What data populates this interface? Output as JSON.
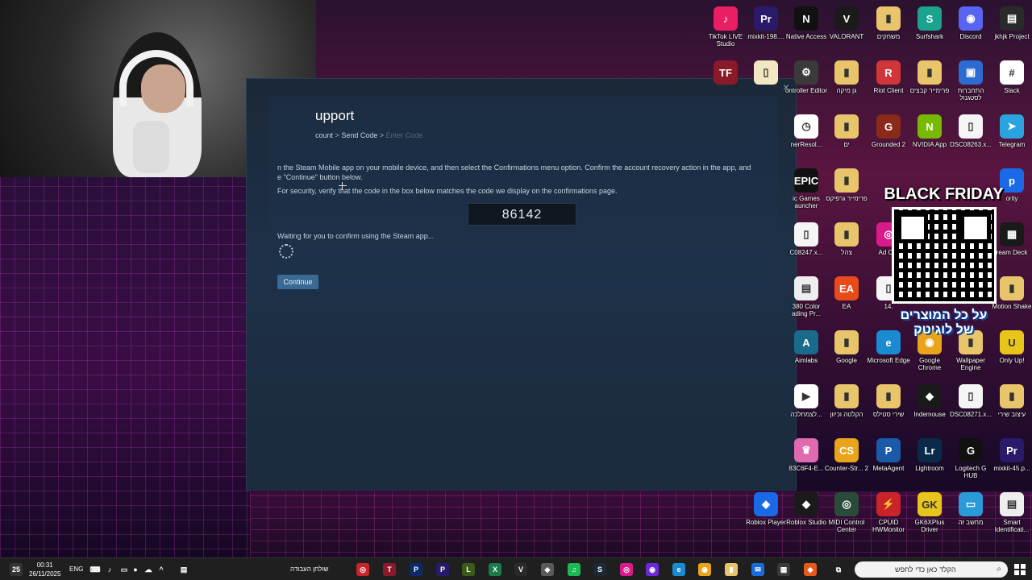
{
  "steam": {
    "title": "upport",
    "breadcrumb": [
      "count",
      "Send Code",
      "Enter Code"
    ],
    "crumb_sep": ">",
    "instruction_line1": "n the Steam Mobile app on your mobile device, and then select the Confirmations menu option. Confirm the account recovery action in the app, and",
    "instruction_line2": "e \"Continue\" button below.",
    "security_text": "For security, verify that the code in the box below matches the code we display on the confirmations page.",
    "code": "86142",
    "waiting_text": "Waiting for you to confirm using the Steam app...",
    "continue_label": "Continue",
    "close_glyph": "×"
  },
  "desktop_icons": [
    {
      "label": "TikTok LIVE Studio",
      "glyph": "♪",
      "color": "#e91e63",
      "icon": "tiktok-icon"
    },
    {
      "label": "mixkit-198....",
      "glyph": "Pr",
      "color": "#2a1a6a",
      "icon": "premiere-icon"
    },
    {
      "label": "Native Access",
      "glyph": "N",
      "color": "#111111",
      "icon": "native-access-icon"
    },
    {
      "label": "VALORANT",
      "glyph": "V",
      "color": "#1a1a1a",
      "icon": "valorant-icon"
    },
    {
      "label": "משחקים",
      "glyph": "▮",
      "color": "#e8c56a",
      "icon": "folder-icon"
    },
    {
      "label": "Surfshark",
      "glyph": "S",
      "color": "#1aa38f",
      "icon": "surfshark-icon"
    },
    {
      "label": "Discord",
      "glyph": "◉",
      "color": "#5865f2",
      "icon": "discord-icon"
    },
    {
      "label": "jkhjk Project",
      "glyph": "▤",
      "color": "#2a2a2a",
      "icon": "project-icon"
    },
    {
      "label": "",
      "glyph": "TF",
      "color": "#8a1a2a",
      "icon": "tf-icon"
    },
    {
      "label": "",
      "glyph": "▯",
      "color": "#f1e7c3",
      "icon": "file-icon"
    },
    {
      "label": "ontroller Editor",
      "glyph": "⚙",
      "color": "#3a3a3a",
      "icon": "controller-icon"
    },
    {
      "label": "גן מיקה",
      "glyph": "▮",
      "color": "#e8c56a",
      "icon": "folder-icon"
    },
    {
      "label": "Riot Client",
      "glyph": "R",
      "color": "#d13639",
      "icon": "riot-icon"
    },
    {
      "label": "פרימייר קבצים",
      "glyph": "▮",
      "color": "#e8c56a",
      "icon": "folder-icon"
    },
    {
      "label": "התחברות לסטגנול",
      "glyph": "▣",
      "color": "#2c6bd1",
      "icon": "connection-icon"
    },
    {
      "label": "Slack",
      "glyph": "#",
      "color": "#ffffff",
      "icon": "slack-icon"
    },
    {
      "label": "nerResol...",
      "glyph": "◷",
      "color": "#ffffff",
      "icon": "clock-icon"
    },
    {
      "label": "ים",
      "glyph": "▮",
      "color": "#e8c56a",
      "icon": "folder-icon"
    },
    {
      "label": "Grounded 2",
      "glyph": "G",
      "color": "#8a2a1a",
      "icon": "grounded-icon"
    },
    {
      "label": "NVIDIA App",
      "glyph": "N",
      "color": "#76b900",
      "icon": "nvidia-icon"
    },
    {
      "label": "DSC08263.x...",
      "glyph": "▯",
      "color": "#f5f5f5",
      "icon": "file-icon"
    },
    {
      "label": "Telegram",
      "glyph": "➤",
      "color": "#2aa3e0",
      "icon": "telegram-icon"
    },
    {
      "label": "ic Games auncher",
      "glyph": "EPIC",
      "color": "#111111",
      "icon": "epic-icon"
    },
    {
      "label": "פרימייר גרפיקס",
      "glyph": "▮",
      "color": "#e8c56a",
      "icon": "folder-icon"
    },
    {
      "label": "C08247.x...",
      "glyph": "▯",
      "color": "#f5f5f5",
      "icon": "file-icon"
    },
    {
      "label": "צהל",
      "glyph": "▮",
      "color": "#e8c56a",
      "icon": "folder-icon"
    },
    {
      "label": "ream Deck",
      "glyph": "▦",
      "color": "#1a1a1a",
      "icon": "stream-deck-icon"
    },
    {
      "label": "380 Color ading Pr...",
      "glyph": "▤",
      "color": "#eeeeee",
      "icon": "preset-icon"
    },
    {
      "label": "EA",
      "glyph": "EA",
      "color": "#e84a1a",
      "icon": "ea-icon"
    },
    {
      "label": "Motion Shake",
      "glyph": "▮",
      "color": "#e8c56a",
      "icon": "folder-icon"
    },
    {
      "label": "Aimlabs",
      "glyph": "A",
      "color": "#1a6a8a",
      "icon": "aimlabs-icon"
    },
    {
      "label": "Google",
      "glyph": "▮",
      "color": "#e8c56a",
      "icon": "folder-icon"
    },
    {
      "label": "Microsoft Edge",
      "glyph": "e",
      "color": "#1a8ad1",
      "icon": "edge-icon"
    },
    {
      "label": "Google Chrome",
      "glyph": "◉",
      "color": "#e8a41a",
      "icon": "chrome-icon"
    },
    {
      "label": "Wallpaper Engine",
      "glyph": "▮",
      "color": "#e8c56a",
      "icon": "folder-icon"
    },
    {
      "label": "Only Up!",
      "glyph": "U",
      "color": "#e8c51a",
      "icon": "only-up-icon"
    },
    {
      "label": "לצמחלכה...",
      "glyph": "▶",
      "color": "#ffffff",
      "icon": "video-icon"
    },
    {
      "label": "הקלטה וכיוון",
      "glyph": "▮",
      "color": "#e8c56a",
      "icon": "folder-icon"
    },
    {
      "label": "שירי סטילס",
      "glyph": "▮",
      "color": "#e8c56a",
      "icon": "folder-icon"
    },
    {
      "label": "Indemouse",
      "glyph": "◆",
      "color": "#1a1a1a",
      "icon": "indemouse-icon"
    },
    {
      "label": "DSC08271.x...",
      "glyph": "▯",
      "color": "#f5f5f5",
      "icon": "file-icon"
    },
    {
      "label": "עיצוב שירי",
      "glyph": "▮",
      "color": "#e8c56a",
      "icon": "folder-icon"
    },
    {
      "label": "83C6F4-E...",
      "glyph": "♛",
      "color": "#e06ab0",
      "icon": "image-icon"
    },
    {
      "label": "Counter-Str... 2",
      "glyph": "CS",
      "color": "#e8a41a",
      "icon": "cs2-icon"
    },
    {
      "label": "MetaAgent",
      "glyph": "P",
      "color": "#1a5aa8",
      "icon": "metaagent-icon"
    },
    {
      "label": "Lightroom",
      "glyph": "Lr",
      "color": "#0a2a4a",
      "icon": "lightroom-icon"
    },
    {
      "label": "Logitech G HUB",
      "glyph": "G",
      "color": "#111111",
      "icon": "ghub-icon"
    },
    {
      "label": "mixkit-45.p...",
      "glyph": "Pr",
      "color": "#2a1a6a",
      "icon": "premiere-project-icon"
    },
    {
      "label": "Roblox Player",
      "glyph": "◆",
      "color": "#1a6ae8",
      "icon": "roblox-player-icon"
    },
    {
      "label": "Roblox Studio",
      "glyph": "◆",
      "color": "#1a1a1a",
      "icon": "roblox-studio-icon"
    },
    {
      "label": "MIDI Control Center",
      "glyph": "◎",
      "color": "#2a4a3a",
      "icon": "midi-icon"
    },
    {
      "label": "CPUID HWMonitor",
      "glyph": "⚡",
      "color": "#c8242a",
      "icon": "hwmonitor-icon"
    },
    {
      "label": "GK6XPlus Driver",
      "glyph": "GK",
      "color": "#e8c51a",
      "icon": "gk6x-icon"
    },
    {
      "label": "מחשב זה",
      "glyph": "▭",
      "color": "#2a9ad8",
      "icon": "this-pc-icon"
    },
    {
      "label": "Smart Identificati...",
      "glyph": "▤",
      "color": "#eeeeee",
      "icon": "smart-id-icon"
    },
    {
      "label": "Ad Cre",
      "glyph": "◎",
      "color": "#d81a8a",
      "icon": "app-icon"
    },
    {
      "label": "14.",
      "glyph": "▯",
      "color": "#f5f5f5",
      "icon": "file-icon"
    },
    {
      "label": "ority",
      "glyph": "p",
      "color": "#1a6ae8",
      "icon": "app-icon"
    }
  ],
  "ad": {
    "title": "BLACK FRIDAY",
    "subtitle_line1": "על כל המוצרים",
    "subtitle_line2": "של לוגיטק"
  },
  "taskbar": {
    "time": "00:31",
    "date": "26/11/2025",
    "lang": "ENG",
    "work_label": "שולחן העבודה",
    "search_placeholder": "הקלד כאן כדי לחפש",
    "badge": "25"
  }
}
